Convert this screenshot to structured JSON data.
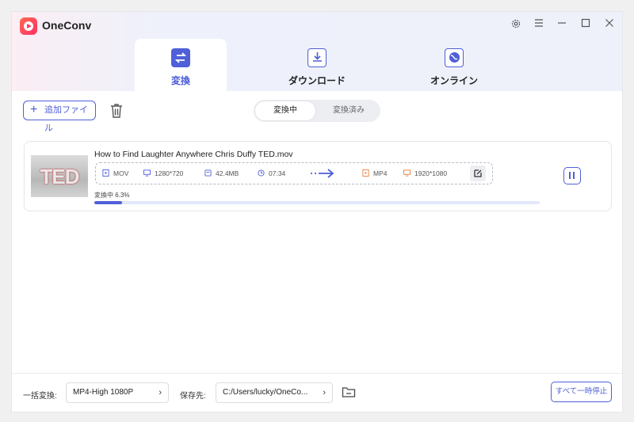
{
  "app": {
    "title": "OneConv"
  },
  "window_controls": {
    "settings": "settings-icon",
    "menu": "menu-icon",
    "minimize": "minimize-icon",
    "maximize": "maximize-icon",
    "close": "close-icon"
  },
  "tabs": [
    {
      "label": "変換",
      "icon": "convert-icon",
      "active": true
    },
    {
      "label": "ダウンロード",
      "icon": "download-icon",
      "active": false
    },
    {
      "label": "オンライン",
      "icon": "online-icon",
      "active": false
    }
  ],
  "toolbar": {
    "add_file_label": "追加ファイル",
    "segments": [
      {
        "label": "変換中",
        "active": true
      },
      {
        "label": "変換済み",
        "active": false
      }
    ]
  },
  "task": {
    "file_name": "How to Find Laughter Anywhere  Chris Duffy  TED.mov",
    "thumbnail_text": "TED",
    "source": {
      "format": "MOV",
      "resolution": "1280*720",
      "size": "42.4MB",
      "duration": "07:34"
    },
    "target": {
      "format": "MP4",
      "resolution": "1920*1080"
    },
    "progress_label": "変換中 6.3%",
    "progress_fraction": 0.063
  },
  "footer": {
    "batch_label": "一括変換:",
    "batch_value": "MP4-High 1080P",
    "save_label": "保存先:",
    "save_path": "C:/Users/lucky/OneCo...",
    "pause_all_label": "すべて一時停止"
  },
  "colors": {
    "accent": "#4f5fd8",
    "logo": "#ff3a60",
    "orange": "#e8813a"
  }
}
